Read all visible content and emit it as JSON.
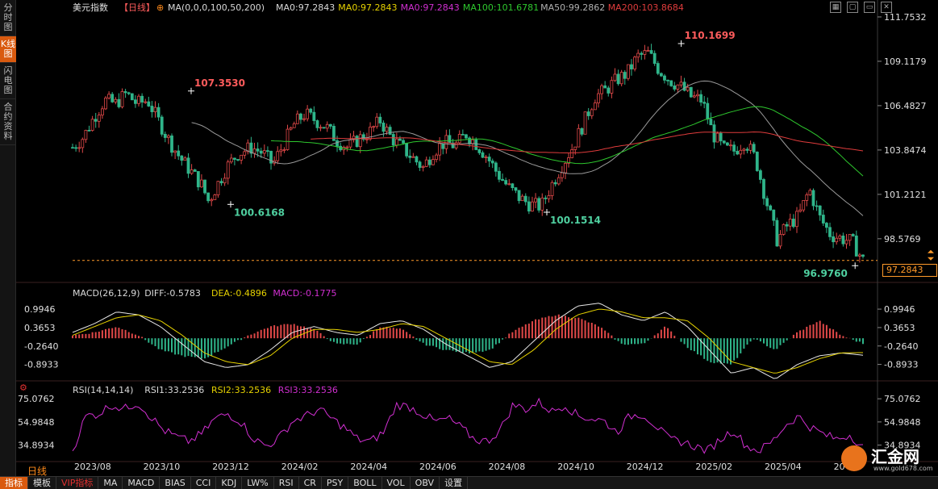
{
  "sidebar": {
    "tabs": [
      {
        "label": "分时图",
        "active": false
      },
      {
        "label": "K线图",
        "active": true
      },
      {
        "label": "闪电图",
        "active": false
      },
      {
        "label": "合约资料",
        "active": false
      }
    ]
  },
  "header": {
    "symbol": "美元指数",
    "period": "【日线】",
    "ma_icon": "⊕",
    "items": [
      {
        "text": "MA(0,0,0,100,50,200)",
        "color": "#d9d9d9"
      },
      {
        "text": "MA0:97.2843",
        "color": "#d9d9d9"
      },
      {
        "text": "MA0:97.2843",
        "color": "#e6d200"
      },
      {
        "text": "MA0:97.2843",
        "color": "#d12fd1"
      },
      {
        "text": "MA100:101.6781",
        "color": "#2ec82e"
      },
      {
        "text": "MA50:99.2862",
        "color": "#b0b0b0"
      },
      {
        "text": "MA200:103.8684",
        "color": "#e03c3c"
      }
    ]
  },
  "top_icons": [
    "grid-icon",
    "window-icon",
    "minimize-icon",
    "close-icon"
  ],
  "top_icon_glyphs": [
    "▦",
    "▢",
    "▭",
    "✕"
  ],
  "price_tag": "97.2843",
  "period_label": "日线",
  "logo": {
    "text": "汇金网",
    "url": "www.gold678.com"
  },
  "bottom_bar": [
    {
      "label": "指标",
      "type": "active"
    },
    {
      "label": "模板",
      "type": "normal"
    },
    {
      "label": "VIP指标",
      "type": "vip"
    },
    {
      "label": "MA",
      "type": "normal"
    },
    {
      "label": "MACD",
      "type": "normal"
    },
    {
      "label": "BIAS",
      "type": "normal"
    },
    {
      "label": "CCI",
      "type": "normal"
    },
    {
      "label": "KDJ",
      "type": "normal"
    },
    {
      "label": "LW%",
      "type": "normal"
    },
    {
      "label": "RSI",
      "type": "normal"
    },
    {
      "label": "CR",
      "type": "normal"
    },
    {
      "label": "PSY",
      "type": "normal"
    },
    {
      "label": "BOLL",
      "type": "normal"
    },
    {
      "label": "VOL",
      "type": "normal"
    },
    {
      "label": "OBV",
      "type": "normal"
    },
    {
      "label": "设置",
      "type": "normal"
    }
  ],
  "chart_data": [
    {
      "type": "candlestick",
      "title": "美元指数【日线】",
      "x_ticks": [
        "2023/08",
        "2023/10",
        "2023/12",
        "2024/02",
        "2024/04",
        "2024/06",
        "2024/08",
        "2024/10",
        "2024/12",
        "2025/02",
        "2025/04",
        "20"
      ],
      "y_ticks": [
        "111.7532",
        "109.1179",
        "106.4827",
        "103.8474",
        "101.2121",
        "98.5769"
      ],
      "ylim": [
        96.7,
        111.8
      ],
      "last_price": 97.2843,
      "annotations": [
        {
          "text": "107.3530",
          "value": 107.353,
          "color": "#ff5c5c",
          "at": 0.15
        },
        {
          "text": "110.1699",
          "value": 110.1699,
          "color": "#ff5c5c",
          "at": 0.77
        },
        {
          "text": "100.6168",
          "value": 100.6168,
          "color": "#4fd0a0",
          "at": 0.2
        },
        {
          "text": "100.1514",
          "value": 100.1514,
          "color": "#4fd0a0",
          "at": 0.6
        },
        {
          "text": "96.9760",
          "value": 96.976,
          "color": "#4fd0a0",
          "at": 0.99
        }
      ],
      "close_path": [
        [
          0,
          104
        ],
        [
          0.03,
          104.6
        ],
        [
          0.06,
          105.8
        ],
        [
          0.09,
          106.8
        ],
        [
          0.12,
          106.6
        ],
        [
          0.15,
          107.2
        ],
        [
          0.18,
          106.6
        ],
        [
          0.21,
          106.8
        ],
        [
          0.24,
          105.6
        ],
        [
          0.27,
          104.4
        ],
        [
          0.3,
          103.4
        ],
        [
          0.33,
          102.6
        ],
        [
          0.36,
          101.8
        ],
        [
          0.38,
          100.8
        ],
        [
          0.4,
          101.6
        ],
        [
          0.43,
          102.8
        ],
        [
          0.46,
          103.6
        ],
        [
          0.5,
          104.0
        ],
        [
          0.53,
          103.7
        ],
        [
          0.56,
          103.0
        ],
        [
          0.59,
          104.2
        ],
        [
          0.62,
          105.4
        ],
        [
          0.65,
          106.0
        ],
        [
          0.68,
          105.6
        ],
        [
          0.71,
          105.2
        ],
        [
          0.74,
          104.4
        ],
        [
          0.77,
          104.0
        ],
        [
          0.8,
          104.5
        ],
        [
          0.83,
          104.9
        ],
        [
          0.86,
          105.6
        ],
        [
          0.89,
          104.6
        ],
        [
          0.92,
          104.0
        ],
        [
          0.95,
          103.4
        ],
        [
          0.98,
          102.8
        ],
        [
          1.01,
          103.8
        ],
        [
          1.04,
          104.3
        ],
        [
          1.07,
          104.1
        ],
        [
          1.1,
          104.8
        ],
        [
          1.13,
          104.2
        ],
        [
          1.16,
          103.4
        ],
        [
          1.19,
          102.4
        ],
        [
          1.22,
          101.6
        ],
        [
          1.25,
          101.0
        ],
        [
          1.28,
          100.6
        ],
        [
          1.31,
          100.5
        ],
        [
          1.34,
          101.8
        ],
        [
          1.37,
          103.0
        ],
        [
          1.4,
          104.1
        ],
        [
          1.43,
          105.5
        ],
        [
          1.46,
          107.0
        ],
        [
          1.49,
          107.4
        ],
        [
          1.52,
          108.0
        ],
        [
          1.55,
          108.4
        ],
        [
          1.58,
          109.4
        ],
        [
          1.61,
          109.6
        ],
        [
          1.64,
          108.6
        ],
        [
          1.67,
          108.0
        ],
        [
          1.7,
          107.6
        ],
        [
          1.73,
          107.0
        ],
        [
          1.76,
          106.8
        ],
        [
          1.79,
          104.8
        ],
        [
          1.82,
          103.9
        ],
        [
          1.85,
          103.8
        ],
        [
          1.88,
          104.4
        ],
        [
          1.91,
          103.3
        ],
        [
          1.94,
          100.8
        ],
        [
          1.97,
          98.5
        ],
        [
          2.0,
          99.4
        ],
        [
          2.03,
          99.9
        ],
        [
          2.06,
          101.5
        ],
        [
          2.09,
          99.8
        ],
        [
          2.12,
          98.8
        ],
        [
          2.15,
          98.6
        ],
        [
          2.18,
          98.4
        ],
        [
          2.21,
          97.3
        ]
      ],
      "series": [
        {
          "name": "MA0",
          "value": 97.2843
        },
        {
          "name": "MA100",
          "value": 101.6781,
          "color": "#2ec82e"
        },
        {
          "name": "MA50",
          "value": 99.2862,
          "color": "#b0b0b0"
        },
        {
          "name": "MA200",
          "value": 103.8684,
          "color": "#e03c3c"
        }
      ]
    },
    {
      "type": "macd",
      "title": "MACD(26,12,9)",
      "legend": [
        {
          "text": "MACD(26,12,9)",
          "color": "#d9d9d9"
        },
        {
          "text": "DIFF:-0.5783",
          "color": "#d9d9d9"
        },
        {
          "text": "DEA:-0.4896",
          "color": "#e6d200"
        },
        {
          "text": "MACD:-0.1775",
          "color": "#d12fd1"
        }
      ],
      "y_ticks": [
        "0.9946",
        "0.3653",
        "-0.2640",
        "-0.8933"
      ],
      "ylim": [
        -1.4,
        1.3
      ],
      "diff": [
        0.2,
        0.5,
        0.9,
        0.8,
        0.4,
        -0.2,
        -0.8,
        -1.0,
        -0.9,
        -0.4,
        0.2,
        0.4,
        0.2,
        0.1,
        0.5,
        0.6,
        0.3,
        -0.2,
        -0.6,
        -1.0,
        -0.8,
        -0.1,
        0.6,
        1.1,
        1.2,
        0.8,
        0.6,
        0.9,
        0.4,
        -0.4,
        -1.2,
        -1.0,
        -1.4,
        -0.9,
        -0.6,
        -0.5,
        -0.58
      ],
      "dea": [
        0.1,
        0.4,
        0.7,
        0.8,
        0.6,
        0.1,
        -0.5,
        -0.8,
        -0.9,
        -0.6,
        0.0,
        0.3,
        0.3,
        0.2,
        0.3,
        0.5,
        0.4,
        0.0,
        -0.4,
        -0.8,
        -0.9,
        -0.4,
        0.3,
        0.8,
        1.0,
        0.9,
        0.7,
        0.7,
        0.6,
        0.0,
        -0.8,
        -1.0,
        -1.2,
        -1.0,
        -0.7,
        -0.5,
        -0.49
      ],
      "bars": [
        0.1,
        0.2,
        0.4,
        0.1,
        -0.4,
        -0.6,
        -0.7,
        -0.3,
        0.1,
        0.4,
        0.5,
        0.3,
        -0.2,
        -0.2,
        0.4,
        0.3,
        -0.2,
        -0.4,
        -0.5,
        -0.4,
        0.2,
        0.6,
        0.8,
        0.7,
        0.4,
        -0.2,
        -0.2,
        0.4,
        -0.3,
        -0.8,
        -0.9,
        0.0,
        -0.4,
        0.2,
        0.6,
        0.1,
        -0.18
      ]
    },
    {
      "type": "line",
      "title": "RSI(14,14,14)",
      "legend": [
        {
          "text": "RSI(14,14,14)",
          "color": "#d9d9d9"
        },
        {
          "text": "RSI1:33.2536",
          "color": "#d9d9d9"
        },
        {
          "text": "RSI2:33.2536",
          "color": "#e6d200"
        },
        {
          "text": "RSI3:33.2536",
          "color": "#d12fd1"
        }
      ],
      "y_ticks": [
        "75.0762",
        "54.9848",
        "34.8934"
      ],
      "ylim": [
        22,
        78
      ],
      "rsi": [
        30,
        60,
        62,
        70,
        66,
        72,
        60,
        48,
        42,
        38,
        45,
        58,
        62,
        55,
        40,
        34,
        42,
        56,
        60,
        66,
        58,
        50,
        40,
        38,
        46,
        70,
        68,
        62,
        55,
        58,
        50,
        40,
        38,
        48,
        70,
        66,
        72,
        64,
        70,
        60,
        58,
        56,
        46,
        60,
        62,
        52,
        40,
        38,
        34,
        30,
        40,
        48,
        34,
        30,
        38,
        52,
        60,
        50,
        44,
        40,
        44,
        33
      ]
    }
  ]
}
